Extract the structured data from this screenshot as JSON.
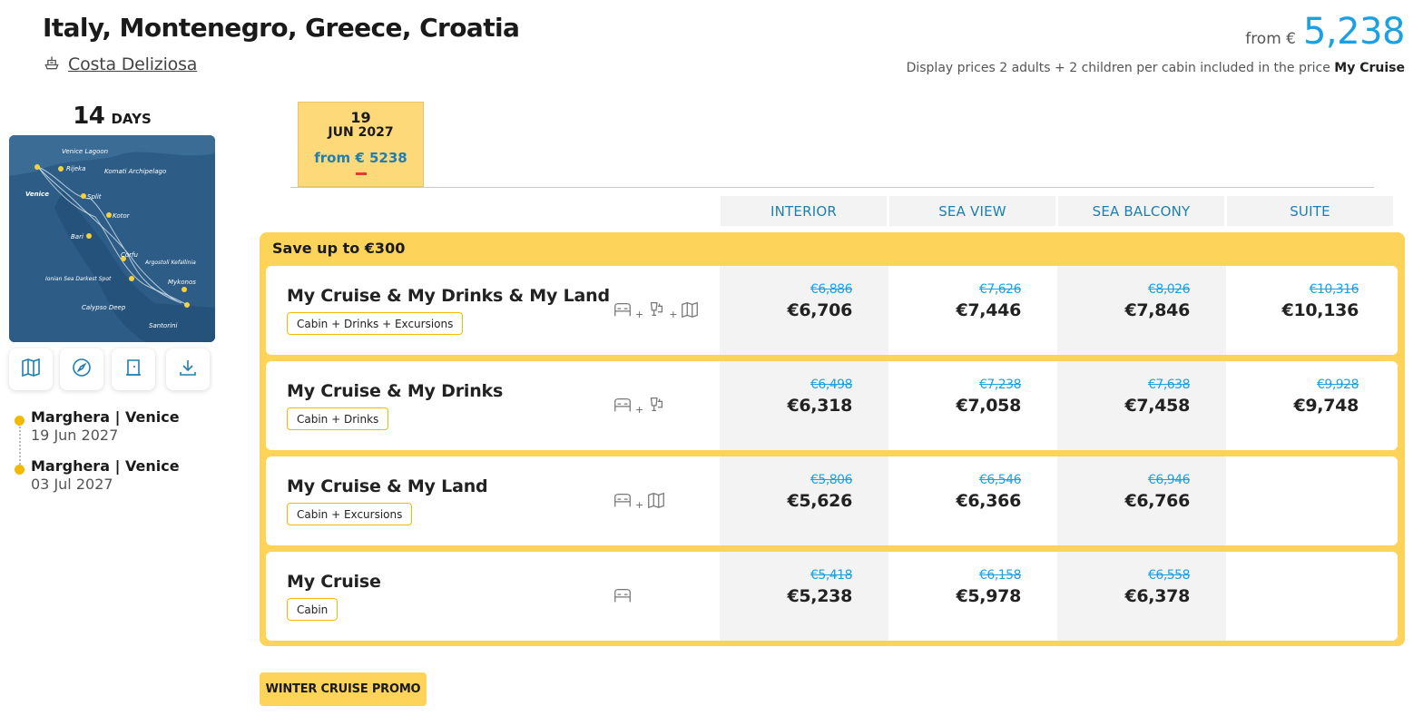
{
  "cruise": {
    "title": "Italy, Montenegro, Greece, Croatia",
    "ship_name": "Costa Deliziosa"
  },
  "price_summary": {
    "from_label": "from €",
    "amount": "5,238",
    "note": "Display prices 2 adults + 2 children per cabin included in the price",
    "note_bold": "My Cruise"
  },
  "duration": {
    "number": "14",
    "unit": "DAYS"
  },
  "map": {
    "labels": [
      "Venice Lagoon",
      "Rijeka",
      "Komati Archipelago",
      "Venice",
      "Split",
      "Kotor",
      "Bari",
      "Corfu",
      "Argostoli Kefallinia",
      "Ionian Sea Darkest Spot",
      "Mykonos",
      "Calypso Deep",
      "Santorini"
    ]
  },
  "tools": [
    "map-icon",
    "compass-icon",
    "deck-plan-icon",
    "download-icon"
  ],
  "itinerary": [
    {
      "port": "Marghera | Venice",
      "date": "19 Jun 2027"
    },
    {
      "port": "Marghera | Venice",
      "date": "03 Jul 2027"
    }
  ],
  "date_tab": {
    "day": "19",
    "month_year": "JUN 2027",
    "from_price": "from € 5238"
  },
  "columns": [
    "INTERIOR",
    "SEA VIEW",
    "SEA BALCONY",
    "SUITE"
  ],
  "offers_box": {
    "save_text": "Save up to €300"
  },
  "offers": [
    {
      "name": "My Cruise & My Drinks & My Land",
      "chip": "Cabin + Drinks + Excursions",
      "icons": [
        "bed-icon",
        "drinks-icon",
        "map-icon"
      ],
      "prices": [
        {
          "old": "€6,886",
          "new": "€6,706"
        },
        {
          "old": "€7,626",
          "new": "€7,446"
        },
        {
          "old": "€8,026",
          "new": "€7,846"
        },
        {
          "old": "€10,316",
          "new": "€10,136"
        }
      ]
    },
    {
      "name": "My Cruise & My Drinks",
      "chip": "Cabin + Drinks",
      "icons": [
        "bed-icon",
        "drinks-icon"
      ],
      "prices": [
        {
          "old": "€6,498",
          "new": "€6,318"
        },
        {
          "old": "€7,238",
          "new": "€7,058"
        },
        {
          "old": "€7,638",
          "new": "€7,458"
        },
        {
          "old": "€9,928",
          "new": "€9,748"
        }
      ]
    },
    {
      "name": "My Cruise & My Land",
      "chip": "Cabin + Excursions",
      "icons": [
        "bed-icon",
        "map-icon"
      ],
      "prices": [
        {
          "old": "€5,806",
          "new": "€5,626"
        },
        {
          "old": "€6,546",
          "new": "€6,366"
        },
        {
          "old": "€6,946",
          "new": "€6,766"
        },
        {
          "old": "",
          "new": ""
        }
      ]
    },
    {
      "name": "My Cruise",
      "chip": "Cabin",
      "icons": [
        "bed-icon"
      ],
      "prices": [
        {
          "old": "€5,418",
          "new": "€5,238"
        },
        {
          "old": "€6,158",
          "new": "€5,978"
        },
        {
          "old": "€6,558",
          "new": "€6,378"
        },
        {
          "old": "",
          "new": ""
        }
      ]
    }
  ],
  "promo": {
    "label": "WINTER CRUISE PROMO"
  }
}
